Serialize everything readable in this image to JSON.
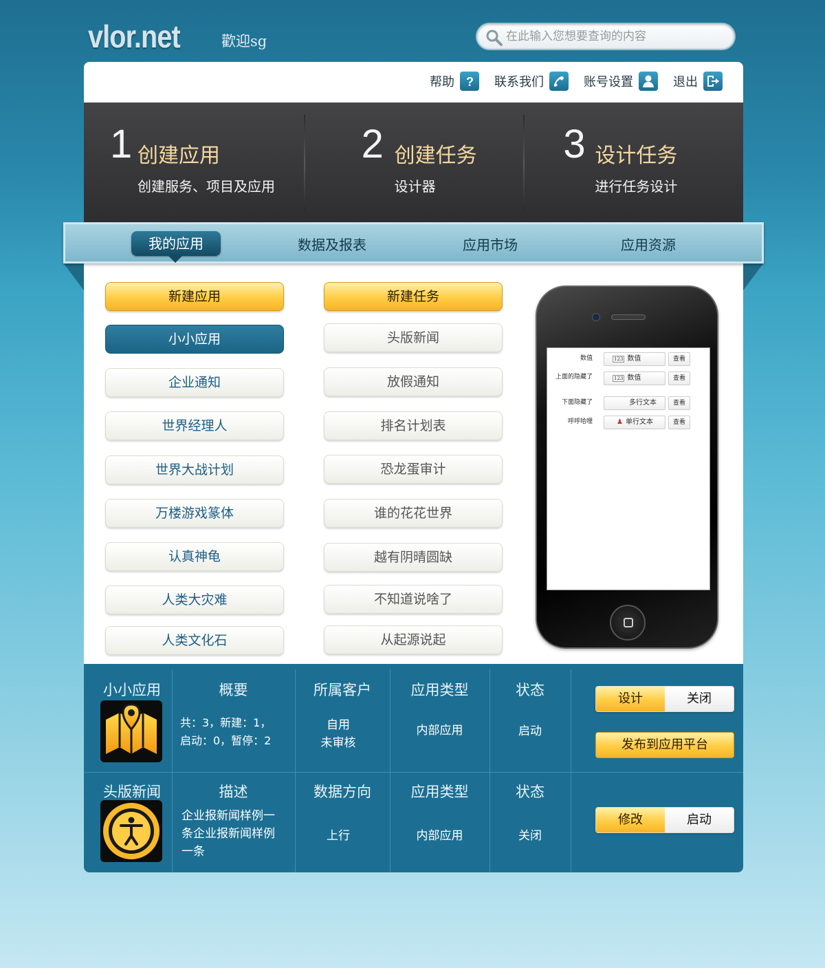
{
  "header": {
    "logo": "vlor.net",
    "welcome": "歡迎sg",
    "search_placeholder": "在此输入您想要查询的内容"
  },
  "toplinks": [
    {
      "label": "帮助",
      "icon": "help-icon"
    },
    {
      "label": "联系我们",
      "icon": "phone-icon"
    },
    {
      "label": "账号设置",
      "icon": "user-icon"
    },
    {
      "label": "退出",
      "icon": "exit-icon"
    }
  ],
  "steps": [
    {
      "num": "1",
      "title": "创建应用",
      "desc": "创建服务、项目及应用"
    },
    {
      "num": "2",
      "title": "创建任务",
      "desc": "设计器"
    },
    {
      "num": "3",
      "title": "设计任务",
      "desc": "进行任务设计"
    }
  ],
  "nav": {
    "active": "我的应用",
    "items": [
      "数据及报表",
      "应用市场",
      "应用资源"
    ]
  },
  "apps": {
    "new_label": "新建应用",
    "items": [
      "小小应用",
      "企业通知",
      "世界经理人",
      "世界大战计划",
      "万楼游戏篆体",
      "认真神龟",
      "人类大灾难",
      "人类文化石"
    ]
  },
  "tasks": {
    "new_label": "新建任务",
    "items": [
      "头版新闻",
      "放假通知",
      "排名计划表",
      "恐龙蛋审计",
      "谁的花花世界",
      "越有阴晴圆缺",
      "不知道说啥了",
      "从起源说起"
    ]
  },
  "phone": {
    "rows": [
      {
        "label": "数值",
        "field": "数值",
        "field_tag": "123",
        "button": "查看"
      },
      {
        "label": "上面的隐藏了",
        "field": "数值",
        "field_tag": "123",
        "button": "查看"
      },
      {
        "label": "下面隐藏了",
        "field": "多行文本",
        "field_tag": "",
        "button": "查看"
      },
      {
        "label": "呼呼哈哩",
        "field": "单行文本",
        "field_tag": "",
        "button": "查看"
      }
    ]
  },
  "details": [
    {
      "name": "小小应用",
      "icon": "map-icon",
      "col1_head": "概要",
      "col1_body": "共：3，新建：1，\n启动：0，暂停：2",
      "col2_head": "所属客户",
      "col2_body": "自用\n未审核",
      "col3_head": "应用类型",
      "col3_body": "内部应用",
      "col4_head": "状态",
      "col4_body": "启动",
      "seg_a": "设计",
      "seg_b": "关闭",
      "publish": "发布到应用平台"
    },
    {
      "name": "头版新闻",
      "icon": "accessibility-icon",
      "col1_head": "描述",
      "col1_body": "企业报新闻样例一\n条企业报新闻样例\n一条",
      "col2_head": "数据方向",
      "col2_body": "上行",
      "col3_head": "应用类型",
      "col3_body": "内部应用",
      "col4_head": "状态",
      "col4_body": "关闭",
      "seg_a": "修改",
      "seg_b": "启动"
    }
  ],
  "colors": {
    "accent_blue": "#1c6f92",
    "accent_yellow": "#ffcd45",
    "step_title": "#f5d9a0"
  }
}
